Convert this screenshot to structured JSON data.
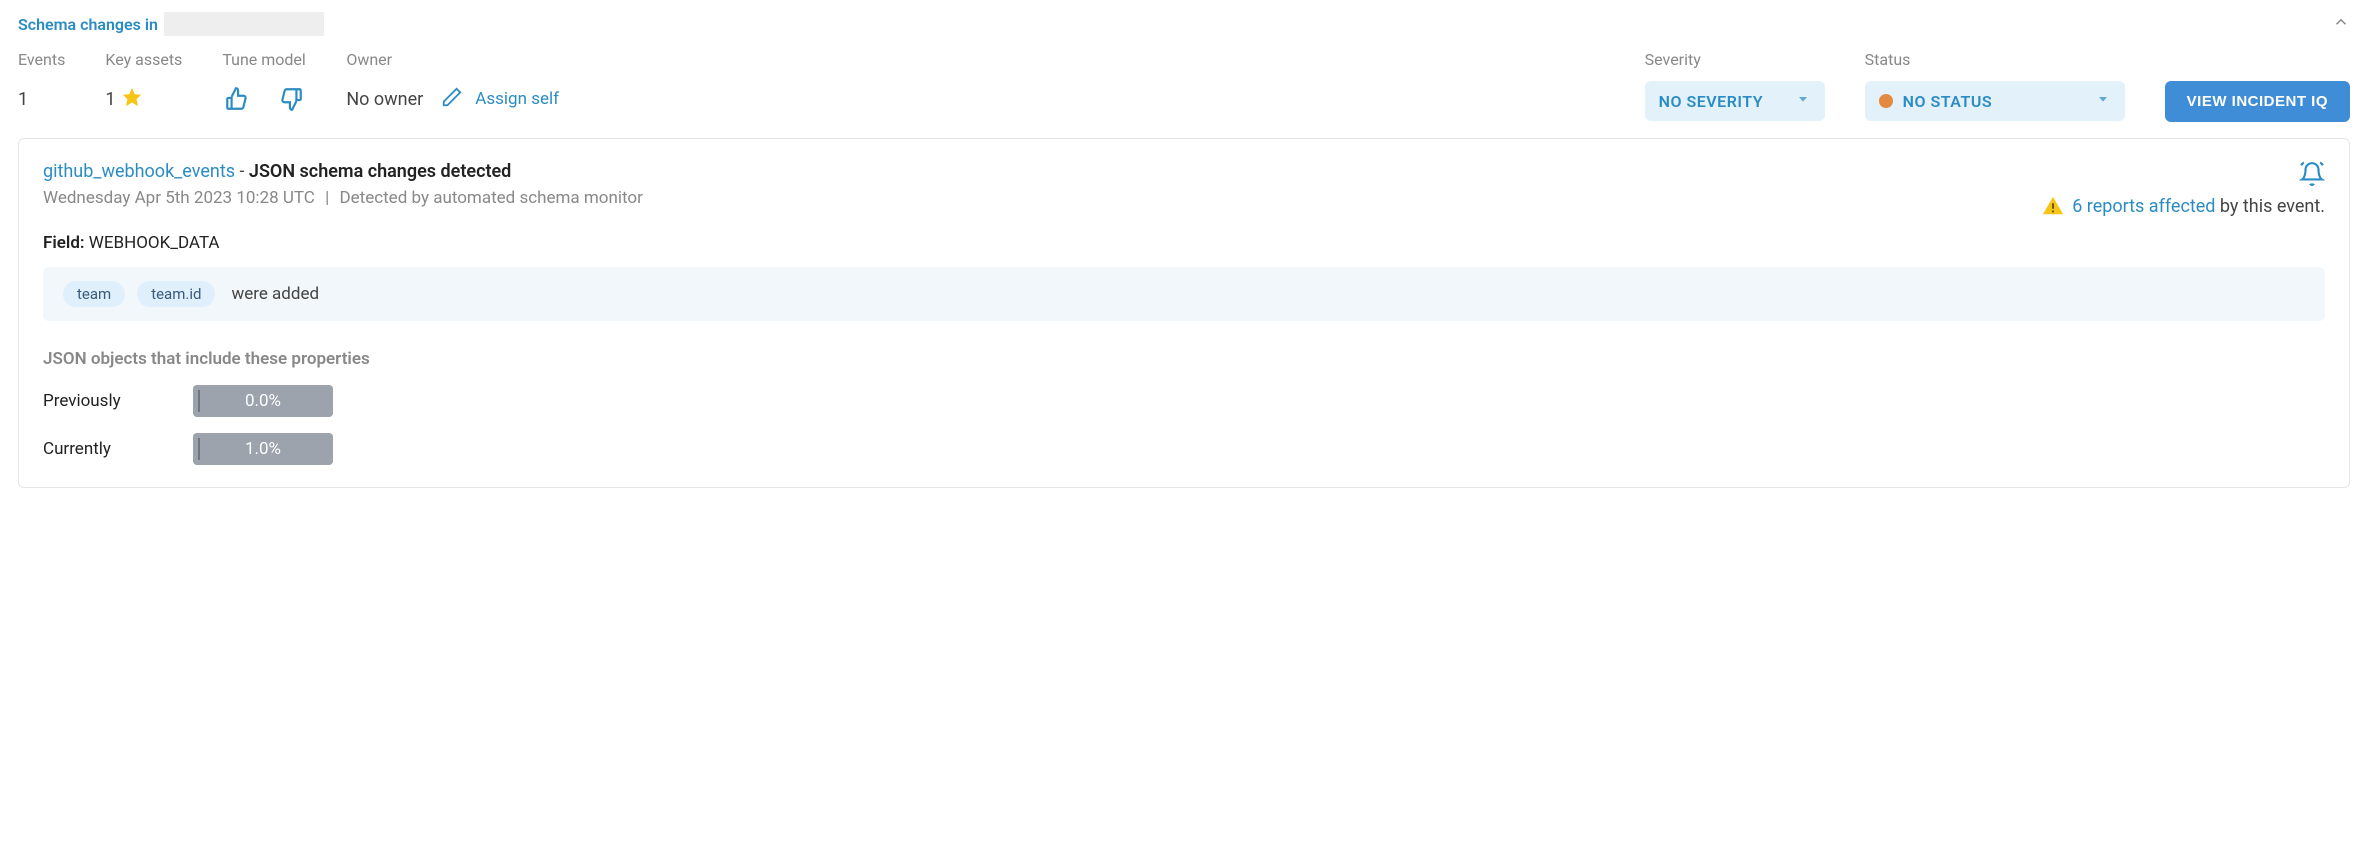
{
  "header": {
    "title_prefix": "Schema changes in"
  },
  "summary": {
    "events": {
      "label": "Events",
      "value": "1"
    },
    "key_assets": {
      "label": "Key assets",
      "value": "1"
    },
    "tune_model": {
      "label": "Tune model"
    },
    "owner": {
      "label": "Owner",
      "value": "No owner",
      "assign_self": "Assign self"
    },
    "severity": {
      "label": "Severity",
      "value": "NO SEVERITY"
    },
    "status": {
      "label": "Status",
      "value": "NO STATUS",
      "dot_color": "#e38a3f"
    },
    "view_iq": "VIEW INCIDENT IQ"
  },
  "event": {
    "source": "github_webhook_events",
    "dash": " - ",
    "title": "JSON schema changes detected",
    "timestamp": "Wednesday Apr 5th 2023 10:28 UTC",
    "detected_by": "Detected by automated schema monitor",
    "reports_affected_count": "6 reports affected",
    "reports_affected_suffix": " by this event.",
    "field_label": "Field:",
    "field_value": "WEBHOOK_DATA",
    "changes": {
      "pills": [
        "team",
        "team.id"
      ],
      "suffix": "were added"
    },
    "json_props_heading": "JSON objects that include these properties",
    "stats": {
      "previously": {
        "label": "Previously",
        "value": "0.0%"
      },
      "currently": {
        "label": "Currently",
        "value": "1.0%"
      }
    }
  }
}
